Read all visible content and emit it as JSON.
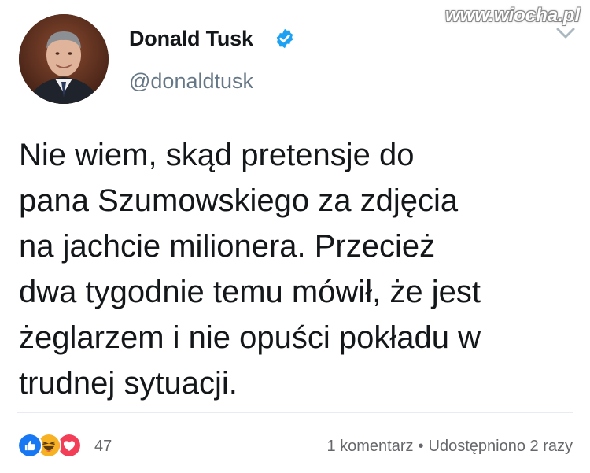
{
  "tweet": {
    "author_name": "Donald Tusk",
    "handle": "@donaldtusk",
    "text_lines": [
      "Nie wiem, skąd pretensje do",
      "pana Szumowskiego za zdjęcia",
      "na jachcie milionera. Przecież",
      "dwa tygodnie temu mówił, że jest",
      "żeglarzem i nie opuści pokładu w",
      "trudnej sytuacji."
    ],
    "verified_icon": "verified-badge-icon",
    "menu_icon": "chevron-down-icon"
  },
  "watermark": "www.wiocha.pl",
  "reactions": {
    "icons": [
      "like-icon",
      "haha-icon",
      "love-icon"
    ],
    "count": "47",
    "comments": "1 komentarz",
    "separator": "•",
    "shares": "Udostępniono 2 razy"
  },
  "colors": {
    "verified_blue": "#1da1f2",
    "like_blue": "#1877f2",
    "haha_yellow": "#f7b125",
    "love_red": "#f33e58",
    "secondary_text": "#657786",
    "fb_grey": "#65676b"
  }
}
